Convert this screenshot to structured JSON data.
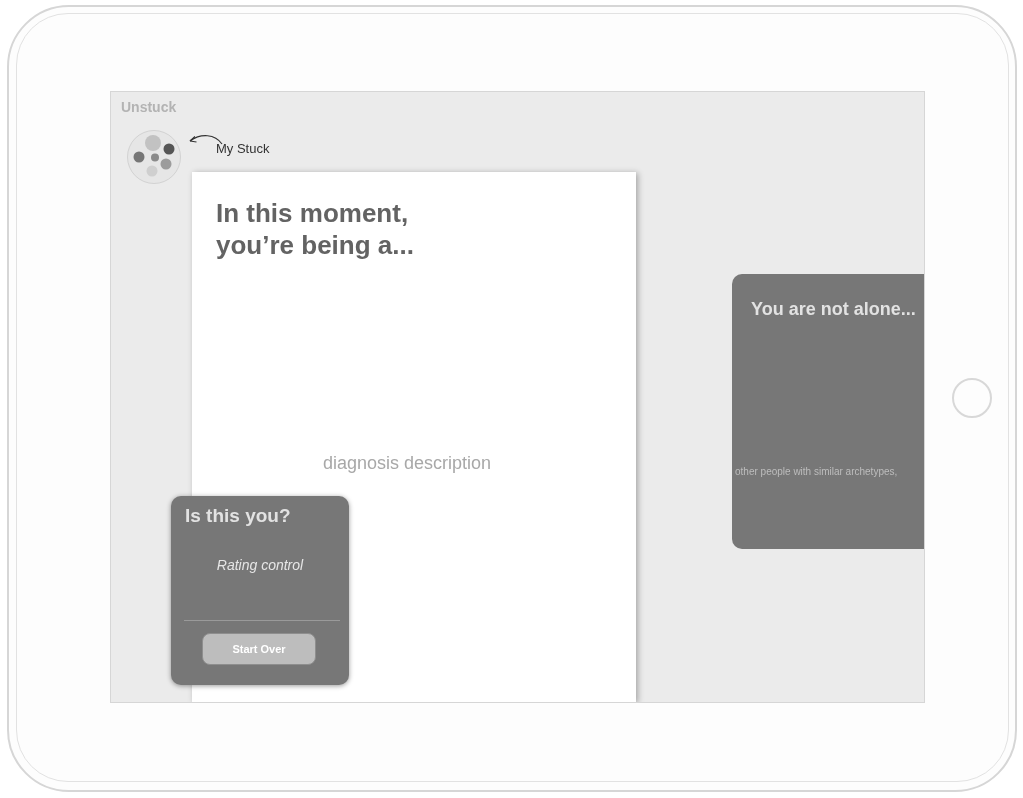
{
  "app": {
    "title": "Unstuck"
  },
  "profile": {
    "label": "My Stuck"
  },
  "diagnosis_card": {
    "heading": "In this moment, you’re being a...",
    "description": "diagnosis description"
  },
  "feedback_card": {
    "title": "Is this you?",
    "rating_note": "Rating control",
    "button": "Start Over"
  },
  "community_card": {
    "title": "You are not alone...",
    "body": "other people with similar archetypes,"
  }
}
